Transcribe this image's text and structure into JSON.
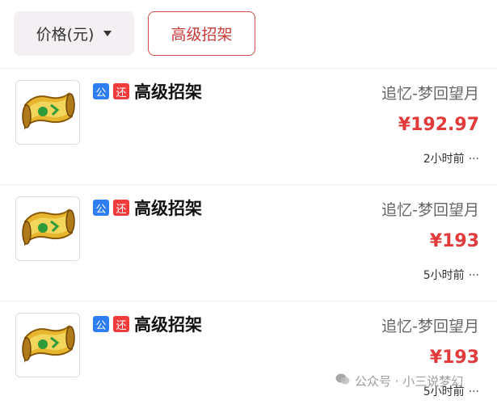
{
  "filters": {
    "price_label": "价格(元)",
    "active_label": "高级招架"
  },
  "items": [
    {
      "badge_public": "公",
      "badge_return": "还",
      "title": "高级招架",
      "server": "追忆-梦回望月",
      "price": "¥192.97",
      "time": "2小时前",
      "more": "···"
    },
    {
      "badge_public": "公",
      "badge_return": "还",
      "title": "高级招架",
      "server": "追忆-梦回望月",
      "price": "¥193",
      "time": "5小时前",
      "more": "···"
    },
    {
      "badge_public": "公",
      "badge_return": "还",
      "title": "高级招架",
      "server": "追忆-梦回望月",
      "price": "¥193",
      "time": "5小时前",
      "more": "···"
    }
  ],
  "watermark": "公众号 · 小三说梦幻",
  "colors": {
    "accent_red": "#e23a3a",
    "badge_blue": "#2d7df3",
    "chip_bg": "#f3eff2"
  },
  "icons": {
    "item": "scroll-icon",
    "price_sort": "caret-down-icon",
    "watermark": "wechat-icon"
  }
}
